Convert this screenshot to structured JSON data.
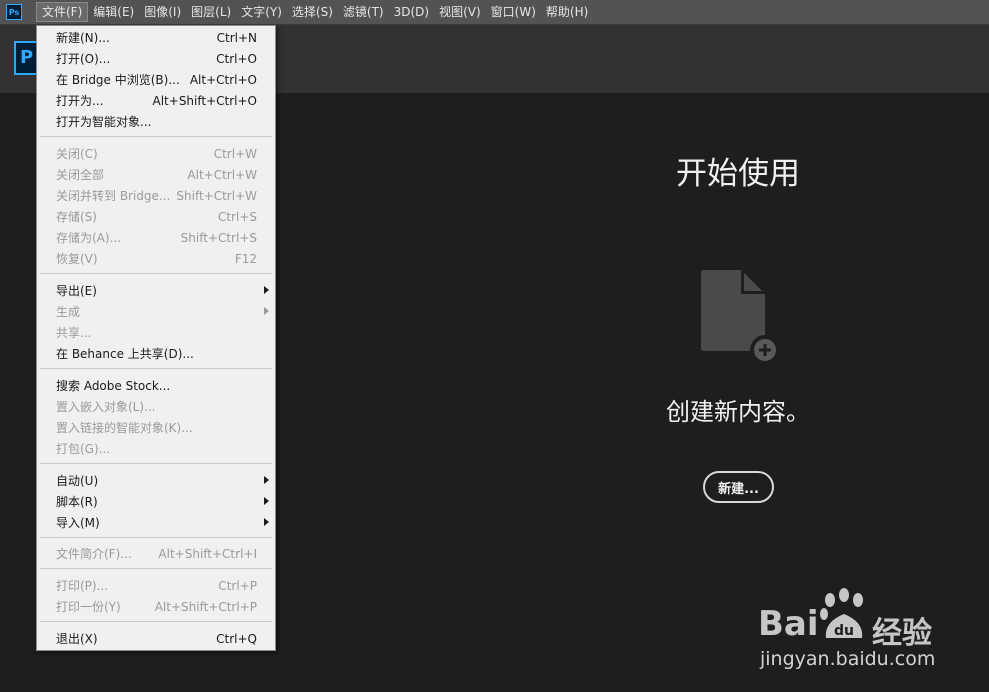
{
  "app": {
    "icon_label": "Ps",
    "big_logo_label": "P"
  },
  "menubar": {
    "items": [
      {
        "label": "文件(F)"
      },
      {
        "label": "编辑(E)"
      },
      {
        "label": "图像(I)"
      },
      {
        "label": "图层(L)"
      },
      {
        "label": "文字(Y)"
      },
      {
        "label": "选择(S)"
      },
      {
        "label": "滤镜(T)"
      },
      {
        "label": "3D(D)"
      },
      {
        "label": "视图(V)"
      },
      {
        "label": "窗口(W)"
      },
      {
        "label": "帮助(H)"
      }
    ]
  },
  "file_menu": {
    "items": [
      {
        "label": "新建(N)...",
        "shortcut": "Ctrl+N",
        "enabled": true
      },
      {
        "label": "打开(O)...",
        "shortcut": "Ctrl+O",
        "enabled": true
      },
      {
        "label": "在 Bridge 中浏览(B)...",
        "shortcut": "Alt+Ctrl+O",
        "enabled": true
      },
      {
        "label": "打开为...",
        "shortcut": "Alt+Shift+Ctrl+O",
        "enabled": true
      },
      {
        "label": "打开为智能对象...",
        "shortcut": "",
        "enabled": true
      },
      {
        "label": "关闭(C)",
        "shortcut": "Ctrl+W",
        "enabled": false
      },
      {
        "label": "关闭全部",
        "shortcut": "Alt+Ctrl+W",
        "enabled": false
      },
      {
        "label": "关闭并转到 Bridge...",
        "shortcut": "Shift+Ctrl+W",
        "enabled": false
      },
      {
        "label": "存储(S)",
        "shortcut": "Ctrl+S",
        "enabled": false
      },
      {
        "label": "存储为(A)...",
        "shortcut": "Shift+Ctrl+S",
        "enabled": false
      },
      {
        "label": "恢复(V)",
        "shortcut": "F12",
        "enabled": false
      },
      {
        "label": "导出(E)",
        "shortcut": "",
        "enabled": true,
        "submenu": true
      },
      {
        "label": "生成",
        "shortcut": "",
        "enabled": false,
        "submenu": true
      },
      {
        "label": "共享...",
        "shortcut": "",
        "enabled": false
      },
      {
        "label": "在 Behance 上共享(D)...",
        "shortcut": "",
        "enabled": true
      },
      {
        "label": "搜索 Adobe Stock...",
        "shortcut": "",
        "enabled": true
      },
      {
        "label": "置入嵌入对象(L)...",
        "shortcut": "",
        "enabled": false
      },
      {
        "label": "置入链接的智能对象(K)...",
        "shortcut": "",
        "enabled": false
      },
      {
        "label": "打包(G)...",
        "shortcut": "",
        "enabled": false
      },
      {
        "label": "自动(U)",
        "shortcut": "",
        "enabled": true,
        "submenu": true
      },
      {
        "label": "脚本(R)",
        "shortcut": "",
        "enabled": true,
        "submenu": true
      },
      {
        "label": "导入(M)",
        "shortcut": "",
        "enabled": true,
        "submenu": true
      },
      {
        "label": "文件简介(F)...",
        "shortcut": "Alt+Shift+Ctrl+I",
        "enabled": false
      },
      {
        "label": "打印(P)...",
        "shortcut": "Ctrl+P",
        "enabled": false
      },
      {
        "label": "打印一份(Y)",
        "shortcut": "Alt+Shift+Ctrl+P",
        "enabled": false
      },
      {
        "label": "退出(X)",
        "shortcut": "Ctrl+Q",
        "enabled": true
      }
    ]
  },
  "start": {
    "title": "开始使用",
    "create_text": "创建新内容。",
    "new_button": "新建...",
    "icons": [
      "new-document-icon",
      "plus-circle-icon"
    ]
  },
  "watermark": {
    "brand": "Bai",
    "brand_paw": "du",
    "product": "经验",
    "url": "jingyan.baidu.com"
  },
  "colors": {
    "accent": "#31a8ff",
    "menu_bg": "#f0f0f0",
    "workspace_bg": "#1e1e1e"
  }
}
